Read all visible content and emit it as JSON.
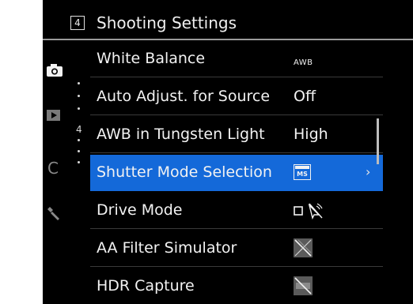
{
  "header": {
    "page_number": "4",
    "title": "Shooting Settings"
  },
  "sidebar": {
    "tabs": [
      {
        "icon": "camera-icon",
        "active": true
      },
      {
        "icon": "playback-icon",
        "active": false
      },
      {
        "icon": "custom-icon",
        "label": "C",
        "active": false
      },
      {
        "icon": "wrench-icon",
        "active": false
      }
    ],
    "sub_page_number": "4"
  },
  "menu": {
    "rows": [
      {
        "label": "White Balance",
        "value": "AWB",
        "value_style": "small"
      },
      {
        "label": "Auto Adjust. for Source",
        "value": "Off"
      },
      {
        "label": "AWB in Tungsten Light",
        "value": "High"
      },
      {
        "label": "Shutter Mode Selection",
        "value": "MS",
        "value_icon": "shutter-mode-ms-icon",
        "selected": true,
        "has_submenu": true
      },
      {
        "label": "Drive Mode",
        "value": "",
        "value_icon": "single-shot-remote-off-icon"
      },
      {
        "label": "AA Filter Simulator",
        "value": "",
        "value_icon": "aa-filter-off-icon"
      },
      {
        "label": "HDR Capture",
        "value": "",
        "value_icon": "hdr-off-icon"
      }
    ],
    "highlight_color": "#1469d9"
  }
}
